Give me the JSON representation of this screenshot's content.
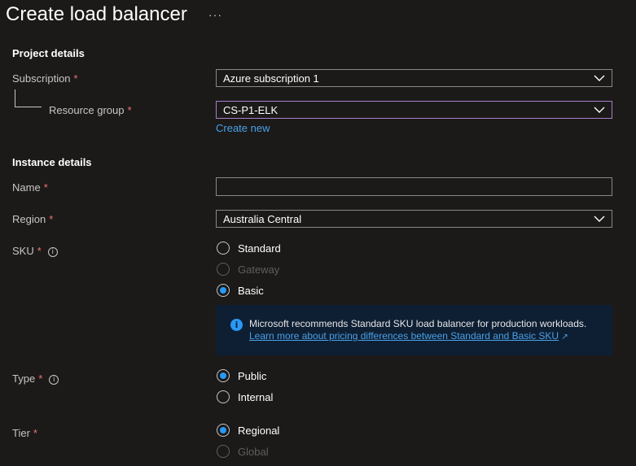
{
  "page": {
    "title": "Create load balancer",
    "more_label": "···"
  },
  "project_details": {
    "heading": "Project details",
    "subscription": {
      "label": "Subscription",
      "required": "*",
      "value": "Azure subscription 1"
    },
    "resource_group": {
      "label": "Resource group",
      "required": "*",
      "value": "CS-P1-ELK",
      "create_new": "Create new"
    }
  },
  "instance_details": {
    "heading": "Instance details",
    "name": {
      "label": "Name",
      "required": "*",
      "value": ""
    },
    "region": {
      "label": "Region",
      "required": "*",
      "value": "Australia Central"
    },
    "sku": {
      "label": "SKU",
      "required": "*",
      "info": "i",
      "options": [
        {
          "label": "Standard",
          "state": "unchecked"
        },
        {
          "label": "Gateway",
          "state": "disabled"
        },
        {
          "label": "Basic",
          "state": "checked"
        }
      ],
      "info_box": {
        "icon": "info-icon",
        "text": "Microsoft recommends Standard SKU load balancer for production workloads.",
        "link": "Learn more about pricing differences between Standard and Basic SKU",
        "link_icon": "↗"
      }
    },
    "type": {
      "label": "Type",
      "required": "*",
      "info": "i",
      "options": [
        {
          "label": "Public",
          "state": "checked"
        },
        {
          "label": "Internal",
          "state": "unchecked"
        }
      ]
    },
    "tier": {
      "label": "Tier",
      "required": "*",
      "options": [
        {
          "label": "Regional",
          "state": "checked"
        },
        {
          "label": "Global",
          "state": "disabled"
        }
      ]
    }
  },
  "colors": {
    "background": "#1b1a19",
    "accent": "#2899f5",
    "required": "#f1707b",
    "link": "#4aa0e6",
    "focus_border": "#a87fc7"
  }
}
